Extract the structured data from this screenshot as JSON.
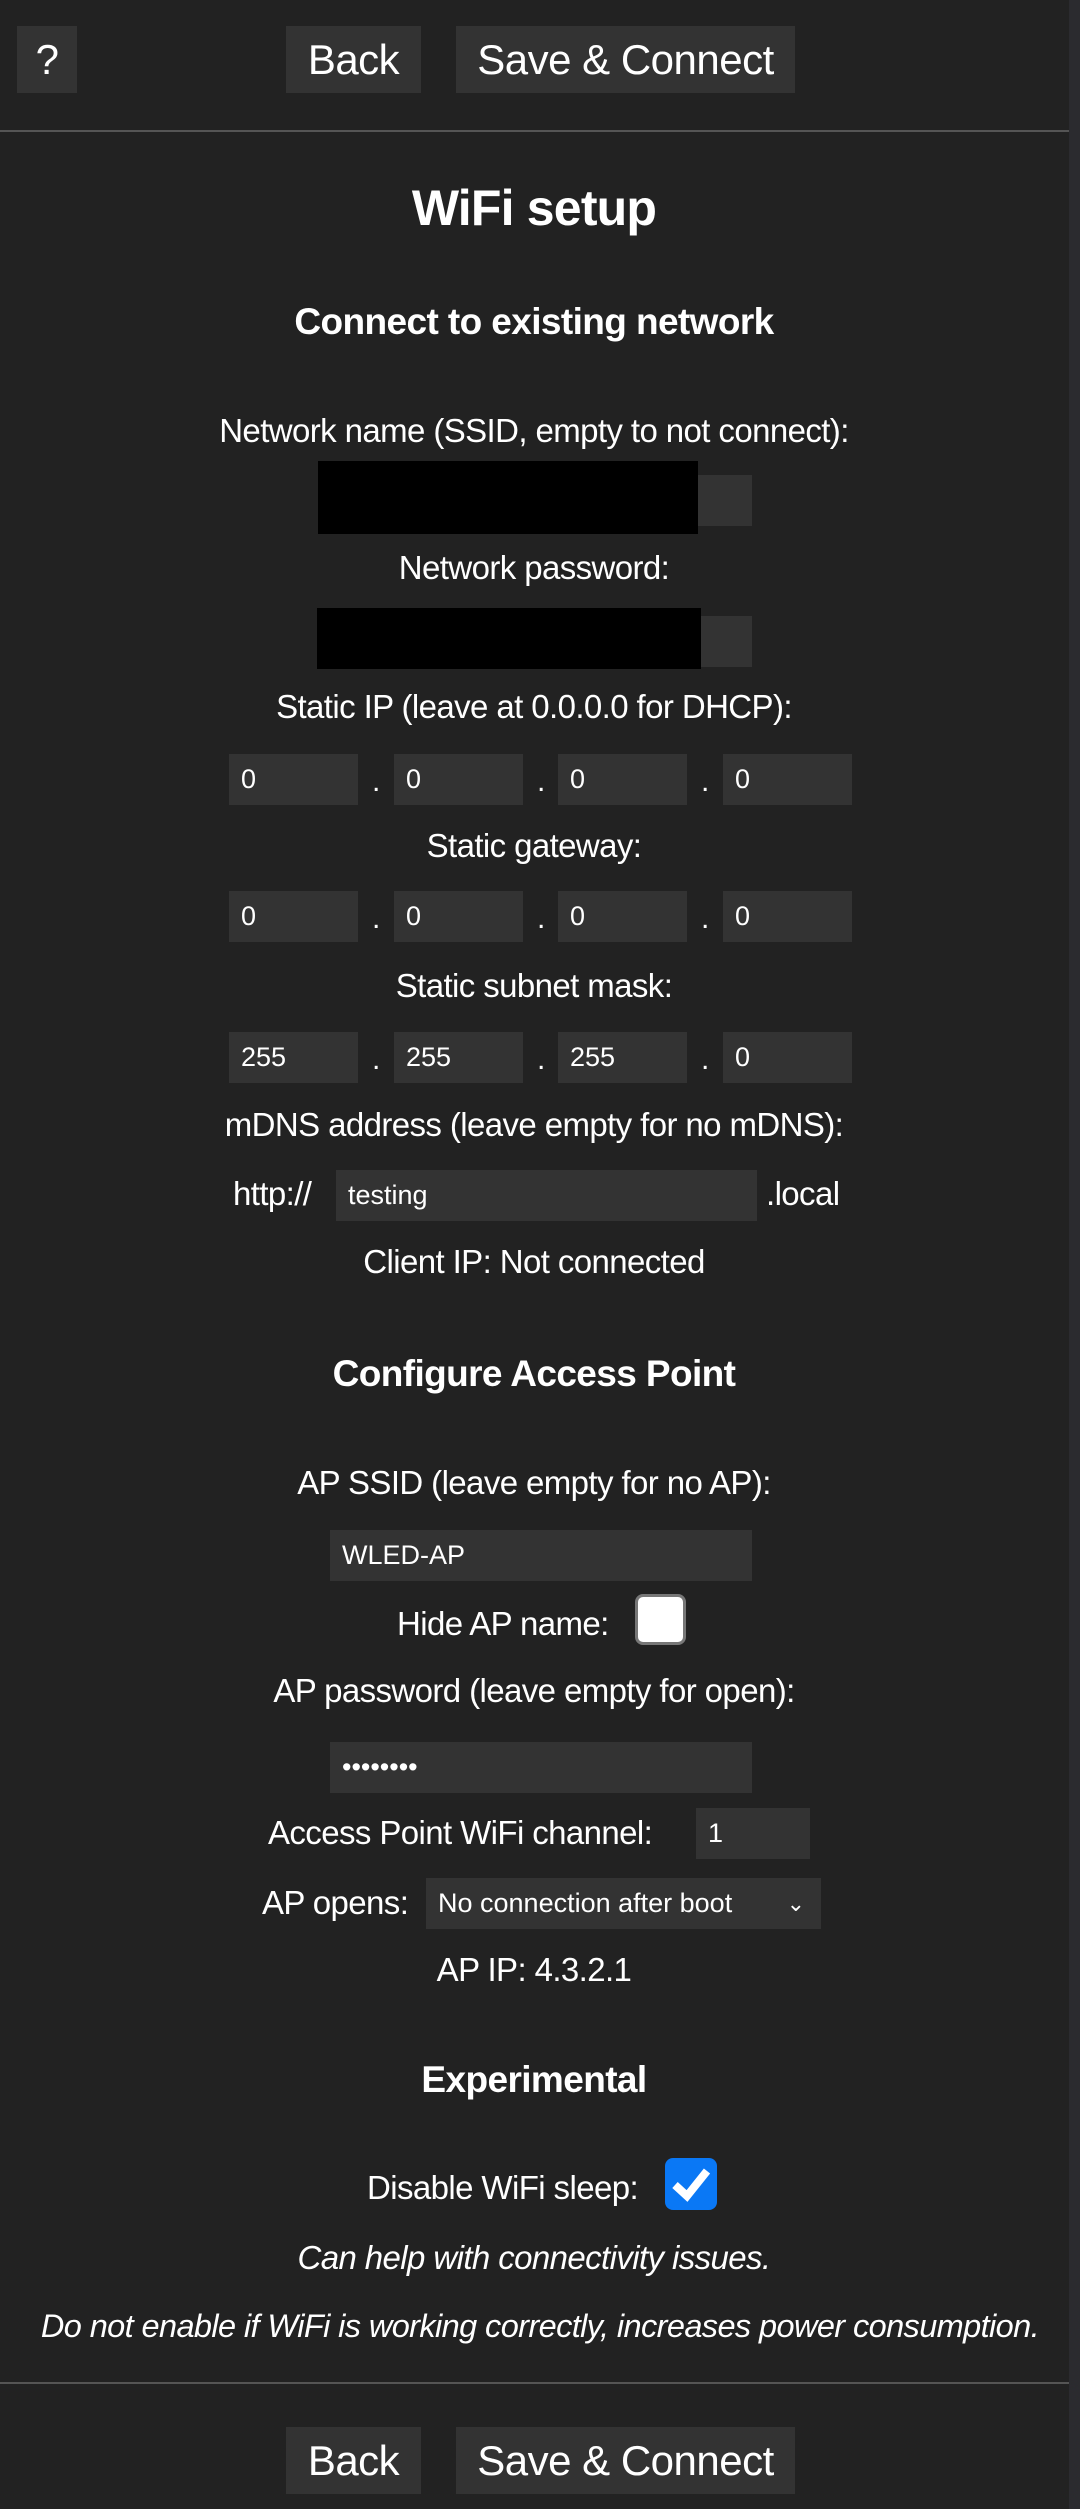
{
  "toolbar": {
    "help_label": "?",
    "back_label": "Back",
    "save_label": "Save & Connect"
  },
  "title": "WiFi setup",
  "connect": {
    "heading": "Connect to existing network",
    "ssid_label": "Network name (SSID, empty to not connect):",
    "password_label": "Network password:",
    "static_ip_label": "Static IP (leave at 0.0.0.0 for DHCP):",
    "static_ip": [
      "0",
      "0",
      "0",
      "0"
    ],
    "gateway_label": "Static gateway:",
    "gateway": [
      "0",
      "0",
      "0",
      "0"
    ],
    "subnet_label": "Static subnet mask:",
    "subnet": [
      "255",
      "255",
      "255",
      "0"
    ],
    "ip_separator": ".",
    "mdns_label": "mDNS address (leave empty for no mDNS):",
    "mdns_prefix": "http://",
    "mdns_value": "testing",
    "mdns_suffix": ".local",
    "client_ip": "Client IP: Not connected"
  },
  "ap": {
    "heading": "Configure Access Point",
    "ssid_label": "AP SSID (leave empty for no AP):",
    "ssid_value": "WLED-AP",
    "hide_label": "Hide AP name:",
    "hide_checked": false,
    "password_label": "AP password (leave empty for open):",
    "password_value": "••••••••",
    "channel_label": "Access Point WiFi channel:",
    "channel_value": "1",
    "opens_label": "AP opens:",
    "opens_value": "No connection after boot",
    "ap_ip": "AP IP: 4.3.2.1"
  },
  "experimental": {
    "heading": "Experimental",
    "sleep_label": "Disable WiFi sleep:",
    "sleep_checked": true,
    "note1": "Can help with connectivity issues.",
    "note2": "Do not enable if WiFi is working correctly, increases power consumption."
  },
  "colors": {
    "background": "#222222",
    "input": "#333333",
    "accent": "#0a78f5"
  }
}
